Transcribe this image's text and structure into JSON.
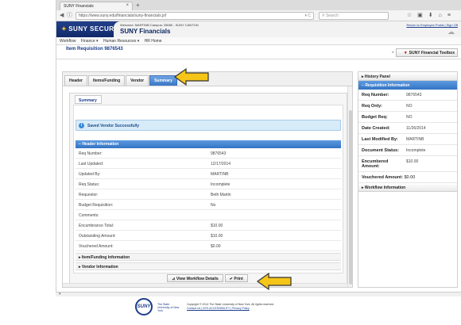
{
  "browser": {
    "tab_title": "SUNY Financials",
    "tab_close": "×",
    "new_tab": "+",
    "url": "https://www.suny.edu/financials/suny-financials.jsf",
    "search_placeholder": "Search"
  },
  "app": {
    "logo_text": "SUNY SECURE",
    "welcome_line": "Welcome: MARTINB   Campus: 28080 - SUNY CANTON",
    "app_name": "SUNY Financials",
    "employee_portal_link": "Return to Employee Portal | Sign Off"
  },
  "menu": {
    "items": [
      "Workflow",
      "Finance ▾",
      "Human Resources ▾",
      "HR Home"
    ]
  },
  "page": {
    "title": "Item Requisition 9876543",
    "toolbox_label": "SUNY Financial Toolbox"
  },
  "tabs": [
    "Header",
    "Items/Funding",
    "Vendor",
    "Summary"
  ],
  "summary": {
    "subtab_label": "Summary",
    "message": "Saved Vendor Successfully",
    "section_header": "Header Information",
    "rows": [
      {
        "label": "Req Number:",
        "value": "9876543"
      },
      {
        "label": "Last Updated:",
        "value": "12/17/2014"
      },
      {
        "label": "Updated By:",
        "value": "MARTINB"
      },
      {
        "label": "Req Status:",
        "value": "Incomplete"
      },
      {
        "label": "Requestor:",
        "value": "Beth Martin"
      },
      {
        "label": "Budget Requisition:",
        "value": "No"
      },
      {
        "label": "Comments:",
        "value": ""
      },
      {
        "label": "Encumbrance Total:",
        "value": "$10.00"
      },
      {
        "label": "Outstanding Amount:",
        "value": "$10.00"
      },
      {
        "label": "Vouchered Amount:",
        "value": "$0.00"
      }
    ],
    "collapsed_sections": [
      "Item/Funding Information",
      "Vendor Information"
    ],
    "buttons": {
      "view_workflow": "View Workflow Details",
      "print": "Print"
    }
  },
  "right_panel": {
    "history_label": "History Panel",
    "req_info_label": "Requisition Information",
    "fields": [
      {
        "label": "Req Number:",
        "value": "9876543"
      },
      {
        "label": "Req Only:",
        "value": "NO"
      },
      {
        "label": "Budget Req:",
        "value": "NO"
      },
      {
        "label": "Date Created:",
        "value": "11/26/2014"
      },
      {
        "label": "Last Modified By:",
        "value": "MARTINB"
      },
      {
        "label": "Document Status:",
        "value": "Incomplete"
      },
      {
        "label": "Encumbered Amount:",
        "value": "$10.00"
      }
    ],
    "vouchered_label": "Vouchered Amount:",
    "vouchered_value": "$0.00",
    "workflow_label": "Workflow Information"
  },
  "footer": {
    "logo_text": "SUNY",
    "logo_sub": "The State University of New York",
    "copyright": "Copyright © 2014 The State University of New York. All rights reserved.",
    "links": "Contact Us | NYS ACCESSIBILITY | Privacy Policy"
  },
  "colors": {
    "brand_blue": "#1a3c8c",
    "section_blue": "#3373c4",
    "arrow_fill": "#f5c518"
  }
}
